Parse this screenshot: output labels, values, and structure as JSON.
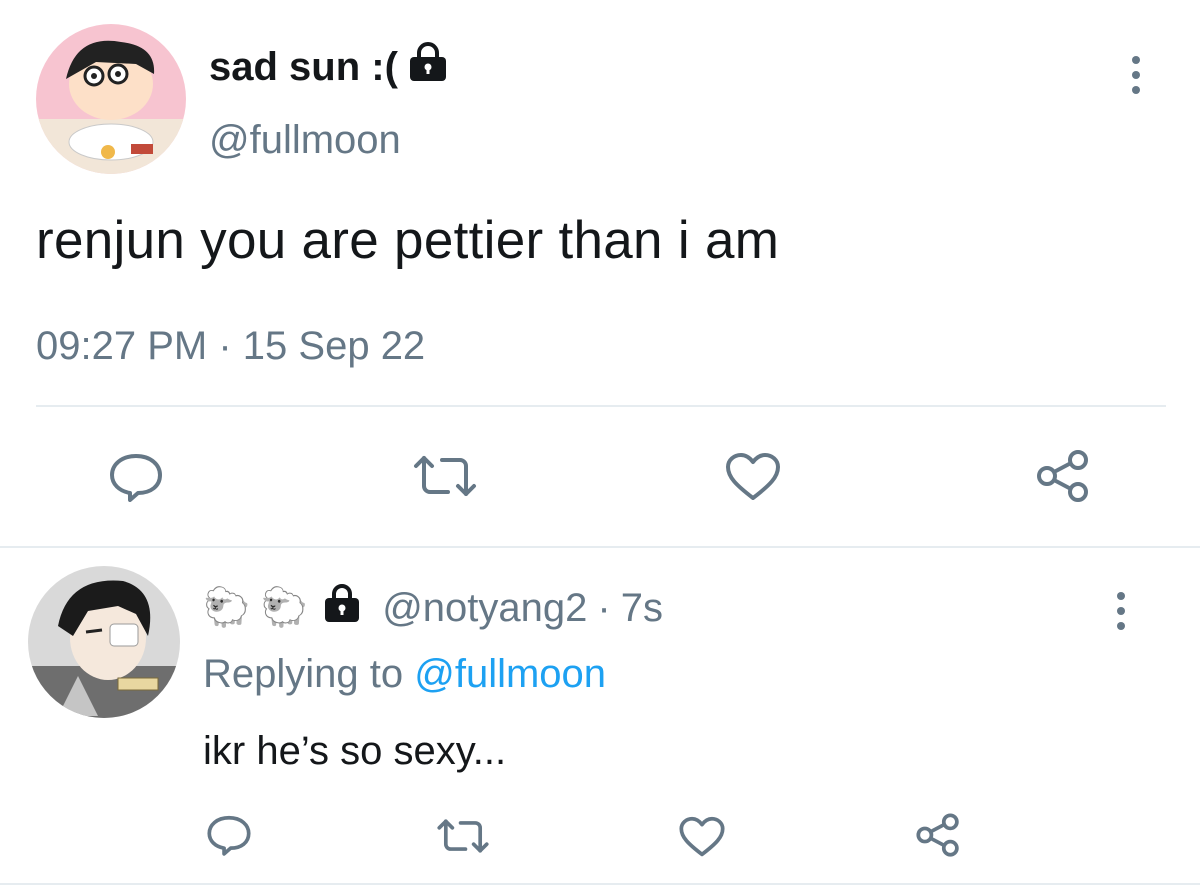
{
  "tweet": {
    "display_name": "sad sun :(",
    "handle": "@fullmoon",
    "text": "renjun you are pettier than i am",
    "time": "09:27 PM",
    "separator": "·",
    "date": "15 Sep 22"
  },
  "reply": {
    "name_emoji": "🐑 🐑",
    "handle": "@notyang2",
    "separator": "·",
    "age": "7s",
    "replying_prefix": "Replying to",
    "replying_handle": "@fullmoon",
    "text": "ikr he’s so sexy..."
  },
  "icons": [
    "lock-icon",
    "more-vertical-icon",
    "reply-icon",
    "retweet-icon",
    "like-icon",
    "share-icon"
  ],
  "colors": {
    "secondary_text": "#657786",
    "link": "#1da1f2",
    "primary_text": "#14171a",
    "divider": "#e6ecf0"
  }
}
